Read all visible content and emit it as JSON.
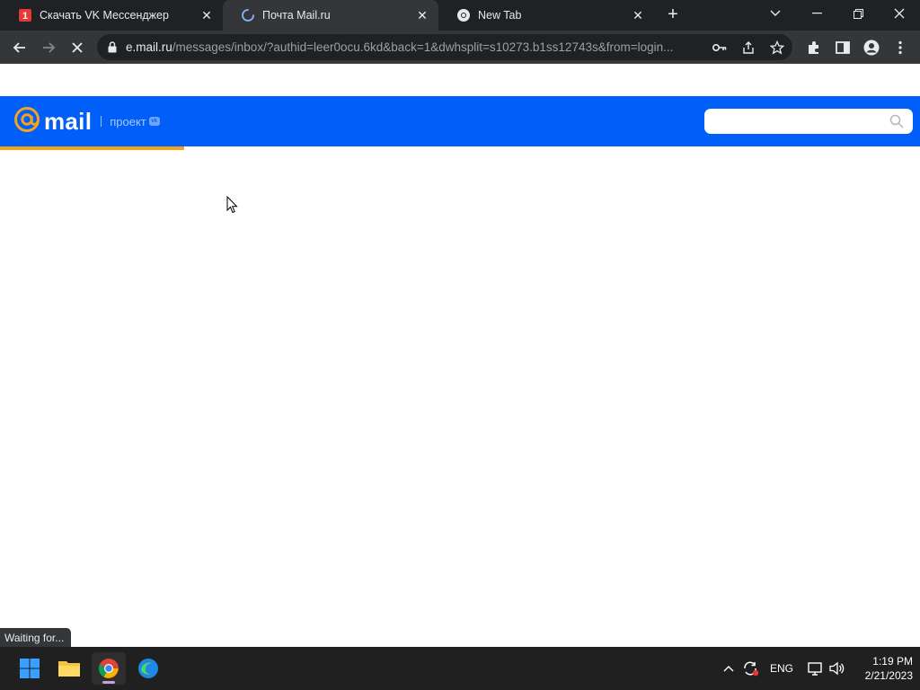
{
  "browser": {
    "tabs": [
      {
        "title": "Скачать VK Мессенджер",
        "icon": "site-red-icon",
        "active": false
      },
      {
        "title": "Почта Mail.ru",
        "icon": "loading-spinner-icon",
        "active": true
      },
      {
        "title": "New Tab",
        "icon": "chrome-icon",
        "active": false
      }
    ],
    "address": {
      "host": "e.mail.ru",
      "path": "/messages/inbox/?authid=leer0ocu.6kd&back=1&dwhsplit=s10273.b1ss12743s&from=login..."
    },
    "status_text": "Waiting for..."
  },
  "mail": {
    "logo_text": "mail",
    "project_label": "проект",
    "vk_badge": "vk",
    "search_placeholder": "",
    "colors": {
      "brand": "#005ff9",
      "accent": "#f5a11c"
    },
    "loading_progress_percent": 20
  },
  "taskbar": {
    "apps": [
      "start-icon",
      "file-explorer-icon",
      "chrome-icon",
      "edge-icon"
    ],
    "language": "ENG",
    "time": "1:19 PM",
    "date": "2/21/2023"
  }
}
